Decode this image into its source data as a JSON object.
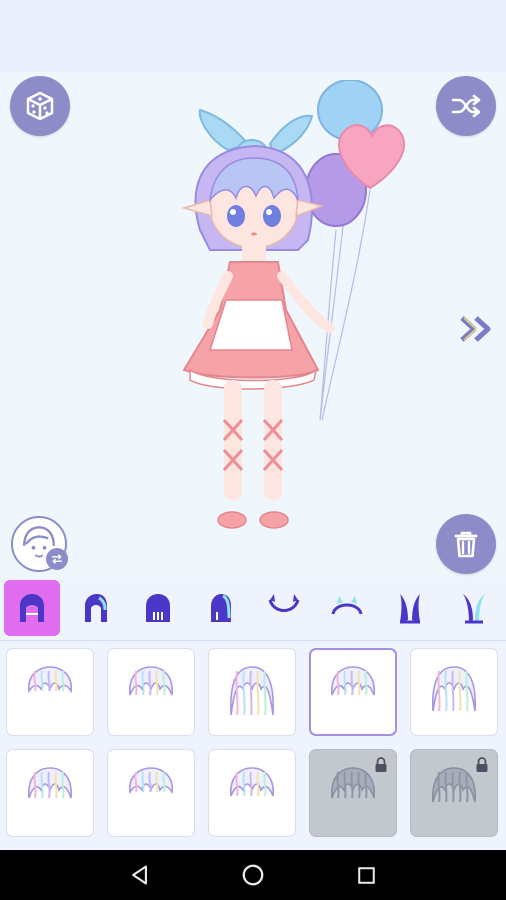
{
  "colors": {
    "accent": "#8e8cc8",
    "active_category": "#e06cf0",
    "selected_border": "#a78ee6",
    "locked_tile": "#c3c7ce"
  },
  "toolbar": {
    "random_icon": "dice-icon",
    "shuffle_icon": "shuffle-icon",
    "next_icon": "double-chevron-right-icon",
    "avatar_icon": "face-swap-icon",
    "trash_icon": "trash-icon"
  },
  "categories": [
    {
      "icon": "hair-full-icon",
      "active": true
    },
    {
      "icon": "hair-front-icon",
      "active": false
    },
    {
      "icon": "hair-back-icon",
      "active": false
    },
    {
      "icon": "hair-side-icon",
      "active": false
    },
    {
      "icon": "horns-icon",
      "active": false
    },
    {
      "icon": "headband-icon",
      "active": false
    },
    {
      "icon": "bunny-ears-icon",
      "active": false
    },
    {
      "icon": "bunny-ears-alt-icon",
      "active": false
    }
  ],
  "items": [
    {
      "icon": "hair-bob-icon",
      "selected": false,
      "locked": false
    },
    {
      "icon": "hair-messy-icon",
      "selected": false,
      "locked": false
    },
    {
      "icon": "hair-long-icon",
      "selected": false,
      "locked": false
    },
    {
      "icon": "hair-short-icon",
      "selected": true,
      "locked": false
    },
    {
      "icon": "hair-wavy-icon",
      "selected": false,
      "locked": false
    },
    {
      "icon": "hair-straight-icon",
      "selected": false,
      "locked": false
    },
    {
      "icon": "hair-curly-icon",
      "selected": false,
      "locked": false
    },
    {
      "icon": "hair-side-part-icon",
      "selected": false,
      "locked": false
    },
    {
      "icon": "hair-spiky-icon",
      "selected": false,
      "locked": true
    },
    {
      "icon": "hair-ponytail-icon",
      "selected": false,
      "locked": true
    }
  ],
  "nav": {
    "back_icon": "back-triangle-icon",
    "home_icon": "home-circle-icon",
    "recents_icon": "recents-square-icon"
  }
}
